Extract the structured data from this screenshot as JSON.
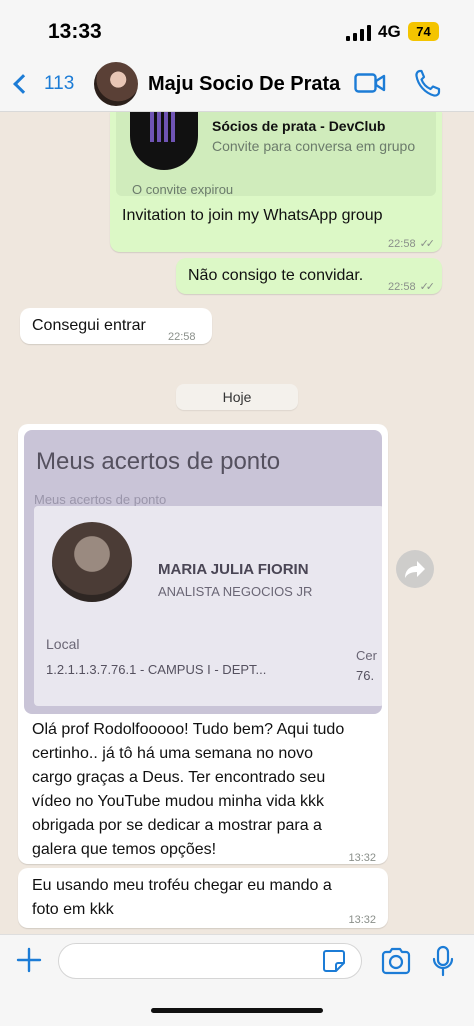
{
  "status_bar": {
    "time": "13:33",
    "network": "4G",
    "battery": "74"
  },
  "header": {
    "back_count": "113",
    "contact_name": "Maju Socio De Prata"
  },
  "invite": {
    "group_name": "Sócios de prata - DevClub",
    "subtitle": "Convite para conversa em grupo",
    "expired": "O convite expirou",
    "text": "Invitation to join my WhatsApp group",
    "time": "22:58"
  },
  "messages": [
    {
      "text": "Não consigo te convidar.",
      "time": "22:58"
    },
    {
      "text": "Consegui entrar",
      "time": "22:58"
    }
  ],
  "day_separator": "Hoje",
  "photo": {
    "title": "Meus acertos de ponto",
    "subtitle": "Meus acertos de ponto",
    "name": "MARIA JULIA FIORIN",
    "role": "ANALISTA NEGOCIOS JR",
    "local_label": "Local",
    "local_value": "1.2.1.1.3.7.76.1 - CAMPUS I - DEPT...",
    "side_label": "Cer",
    "side_value": "76."
  },
  "photo_caption": {
    "lines": [
      "Olá prof Rodolfooooo! Tudo bem? Aqui tudo",
      "certinho.. já tô há uma semana no novo",
      "cargo graças a Deus. Ter encontrado seu",
      "vídeo no YouTube mudou minha vida kkk",
      "obrigada por se dedicar a mostrar para a",
      "galera que temos opções!"
    ],
    "time": "13:32"
  },
  "last_message": {
    "lines": [
      "Eu usando meu troféu chegar eu mando a",
      "foto em kkk"
    ],
    "time": "13:32"
  },
  "composer": {
    "value": ""
  },
  "colors": {
    "accent": "#1c7cd6",
    "outgoing": "#dcf8c6",
    "incoming": "#ffffff",
    "battery": "#f4c400"
  }
}
